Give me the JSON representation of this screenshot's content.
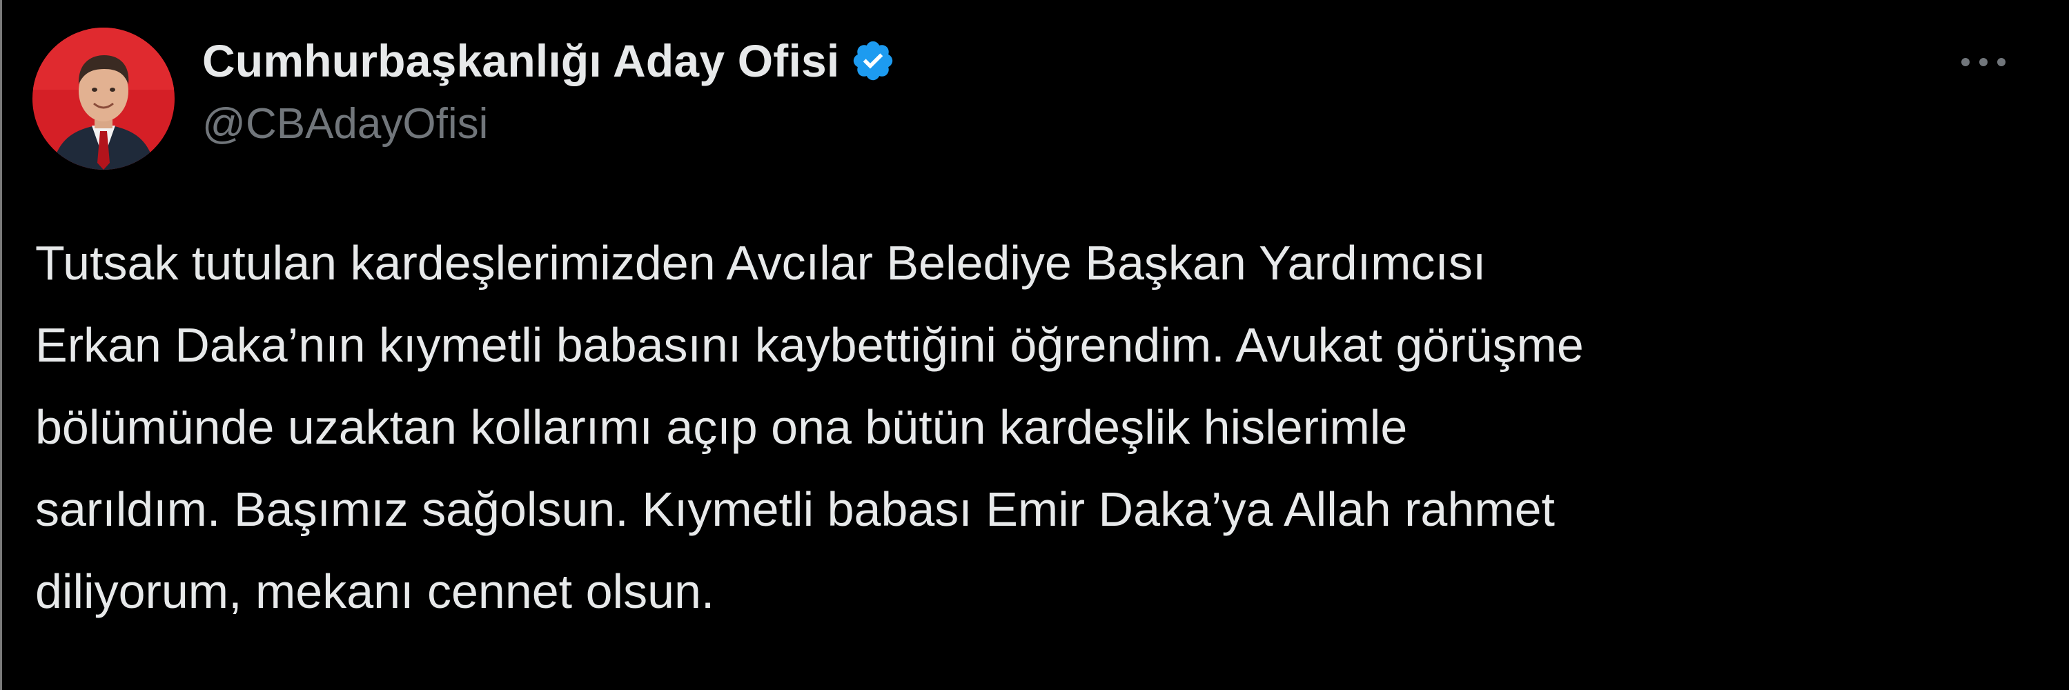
{
  "tweet": {
    "author": {
      "display_name": "Cumhurbaşkanlığı Aday Ofisi",
      "handle": "@CBAdayOfisi",
      "verified": true,
      "verified_icon": "verified-badge-icon",
      "avatar_icon": "profile-avatar"
    },
    "more_icon": "more-options-icon",
    "text": "Tutsak tutulan kardeşlerimizden Avcılar Belediye Başkan Yardımcısı\nErkan Daka’nın kıymetli babasını kaybettiğini öğrendim. Avukat görüşme\nbölümünde uzaktan kollarımı açıp ona bütün kardeşlik hislerimle\nsarıldım. Başımız sağolsun. Kıymetli babası Emir Daka’ya Allah rahmet\ndiliyorum, mekanı cennet olsun."
  },
  "colors": {
    "background": "#000000",
    "primary_text": "#e7e9ea",
    "secondary_text": "#71767b",
    "verified_blue": "#1d9bf0",
    "avatar_background": "#d51f26"
  }
}
